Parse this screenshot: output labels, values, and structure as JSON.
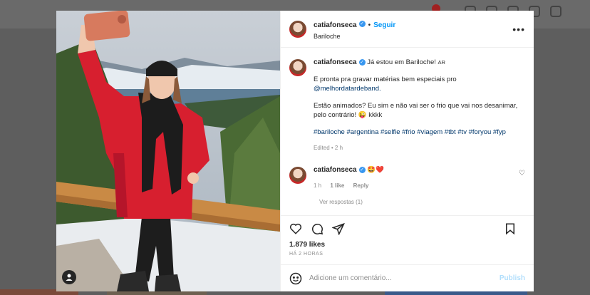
{
  "post": {
    "username": "catiafonseca",
    "follow_label": "Seguir",
    "location": "Bariloche",
    "more_label": "•••",
    "caption": {
      "line1": "Já estou em Bariloche!",
      "ar": "AR",
      "line2": "E pronta pra gravar matérias bem especiais pro",
      "mention": "@melhordatardeband.",
      "line3": "Estão animados? Eu sim e não vai ser o frio que vai nos desanimar, pelo contrário! 😜 kkkk",
      "hashtags": "#bariloche #argentina #selfie #frio #viagem #tbt #tv #foryou #fyp",
      "edited": "Edited • 2 h"
    },
    "reply": {
      "username": "catiafonseca",
      "text": "🤩❤️",
      "time": "1 h",
      "likes": "1 like",
      "reply_label": "Reply",
      "view_replies": "Ver respostas (1)"
    },
    "likes_count": "1.879 likes",
    "posted_time": "HÁ 2 HORAS",
    "comment_placeholder": "Adicione um comentário...",
    "publish_label": "Publish"
  },
  "icons": {
    "heart": "heart-icon",
    "comment": "comment-icon",
    "share": "share-icon",
    "save": "bookmark-icon",
    "emoji": "emoji-icon",
    "user_tag": "user-tag-icon"
  },
  "colors": {
    "accent": "#0095f6",
    "verified": "#3897f0",
    "coat": "#d71f2f"
  }
}
